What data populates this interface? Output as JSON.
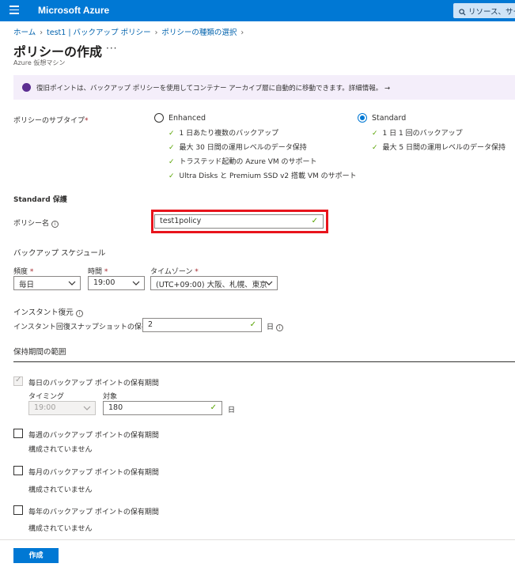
{
  "topbar": {
    "brand": "Microsoft Azure",
    "search_placeholder": "リソース、サービ"
  },
  "breadcrumb": [
    "ホーム",
    "test1 | バックアップ ポリシー",
    "ポリシーの種類の選択"
  ],
  "page": {
    "title": "ポリシーの作成",
    "more": "···",
    "subtitle": "Azure 仮想マシン"
  },
  "banner": {
    "text": "復旧ポイントは、バックアップ ポリシーを使用してコンテナー アーカイブ層に自動的に移動できます。詳細情報。 →"
  },
  "subtype": {
    "label": "ポリシーのサブタイプ",
    "required": "*",
    "enhanced": {
      "label": "Enhanced",
      "features": [
        "1 日あたり複数のバックアップ",
        "最大 30 日間の運用レベルのデータ保持",
        "トラステッド起動の Azure VM のサポート",
        "Ultra Disks と Premium SSD v2 搭載 VM のサポート"
      ]
    },
    "standard": {
      "label": "Standard",
      "selected": true,
      "features": [
        "1 日 1 回のバックアップ",
        "最大 5 日間の運用レベルのデータ保持"
      ]
    }
  },
  "standard_section": {
    "title": "Standard 保護"
  },
  "policy_name": {
    "label": "ポリシー名",
    "value": "test1policy"
  },
  "schedule": {
    "title": "バックアップ スケジュール",
    "frequency": {
      "label": "頻度",
      "required": "*",
      "value": "毎日"
    },
    "time": {
      "label": "時間",
      "required": "*",
      "value": "19:00"
    },
    "timezone": {
      "label": "タイムゾーン",
      "required": "*",
      "value": "(UTC+09:00) 大阪、札幌、東京"
    }
  },
  "instant_restore": {
    "title": "インスタント復元",
    "retention_label": "インスタント回復スナップショットの保有期間",
    "retention_value": "2",
    "unit": "日"
  },
  "retention_range": {
    "title": "保持期間の範囲",
    "daily": {
      "label": "毎日のバックアップ ポイントの保有期間",
      "checked": true,
      "timing_label": "タイミング",
      "timing_value": "19:00",
      "target_label": "対象",
      "target_value": "180",
      "unit": "日"
    },
    "weekly": {
      "label": "毎週のバックアップ ポイントの保有期間",
      "note": "構成されていません"
    },
    "monthly": {
      "label": "毎月のバックアップ ポイントの保有期間",
      "note": "構成されていません"
    },
    "yearly": {
      "label": "毎年のバックアップ ポイントの保有期間",
      "note": "構成されていません"
    }
  },
  "footer": {
    "create_label": "作成"
  },
  "colors": {
    "accent": "#0078d4",
    "success": "#57a300",
    "error": "#e8141c",
    "banner_bg": "#f4eefa"
  }
}
